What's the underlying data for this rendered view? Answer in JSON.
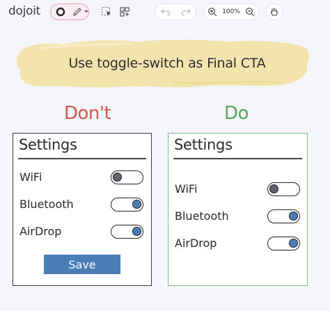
{
  "toolbar": {
    "logo": "dojoit",
    "zoom_level": "100%",
    "icons": [
      "circle-icon",
      "pencil-icon",
      "chevron-down-icon",
      "select-arrow-icon",
      "component-grid-icon",
      "undo-icon",
      "redo-icon",
      "zoom-in-icon",
      "zoom-out-icon",
      "hand-icon"
    ]
  },
  "banner": {
    "text": "Use toggle-switch as Final CTA",
    "color": "#f3e4ae"
  },
  "columns": {
    "dont": {
      "heading": "Don't",
      "color": "#d9534a"
    },
    "do": {
      "heading": "Do",
      "color": "#4fa65a"
    }
  },
  "panels": {
    "dont": {
      "title": "Settings",
      "rows": [
        {
          "label": "WiFi",
          "on": false
        },
        {
          "label": "Bluetooth",
          "on": true
        },
        {
          "label": "AirDrop",
          "on": true
        }
      ],
      "save_label": "Save"
    },
    "do": {
      "title": "Settings",
      "rows": [
        {
          "label": "WiFi",
          "on": false
        },
        {
          "label": "Bluetooth",
          "on": true
        },
        {
          "label": "AirDrop",
          "on": true
        }
      ]
    }
  },
  "colors": {
    "toggle_on_knob": "#4a7db5",
    "toggle_off_knob": "#5f6266",
    "save_button": "#4a7db5"
  }
}
